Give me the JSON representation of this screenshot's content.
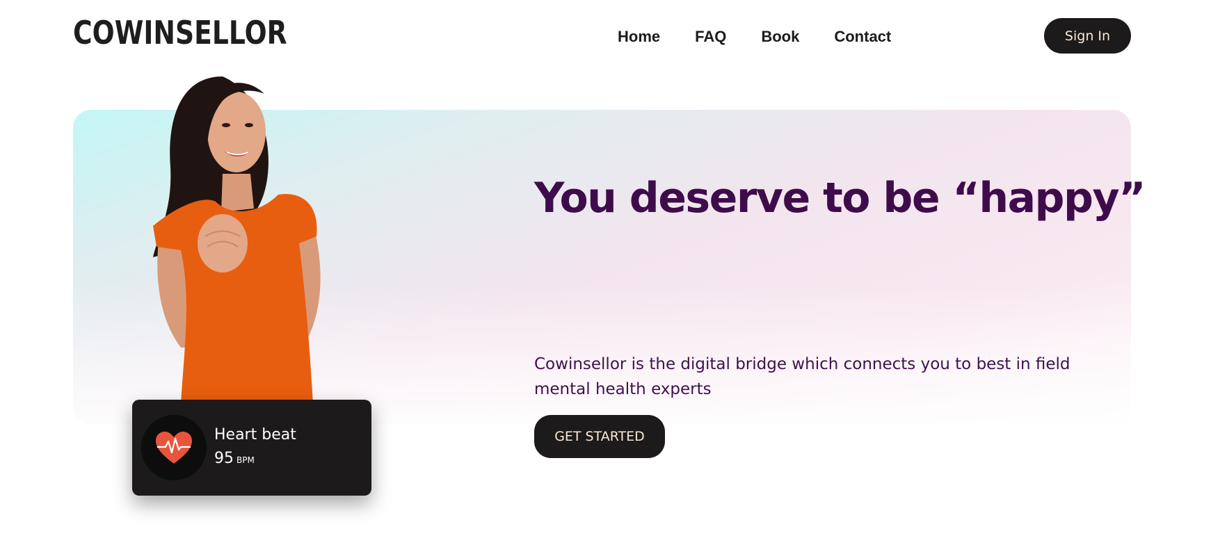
{
  "brand": {
    "logo": "COWINSELLOR"
  },
  "nav": {
    "items": [
      "Home",
      "FAQ",
      "Book",
      "Contact"
    ],
    "sign_in": "Sign In"
  },
  "hero": {
    "headline": "You deserve to be “happy”",
    "description": "Cowinsellor is the digital bridge which connects you to best in field mental health experts",
    "cta": "GET STARTED"
  },
  "heart_card": {
    "title": "Heart beat",
    "value": "95",
    "unit": "BPM",
    "icon": "heart-pulse-icon"
  },
  "colors": {
    "headline": "#3e0c4b",
    "dark_button": "#1c1a1b",
    "button_text": "#fbe9d7",
    "heart": "#e8553d",
    "shirt": "#e85e10"
  }
}
